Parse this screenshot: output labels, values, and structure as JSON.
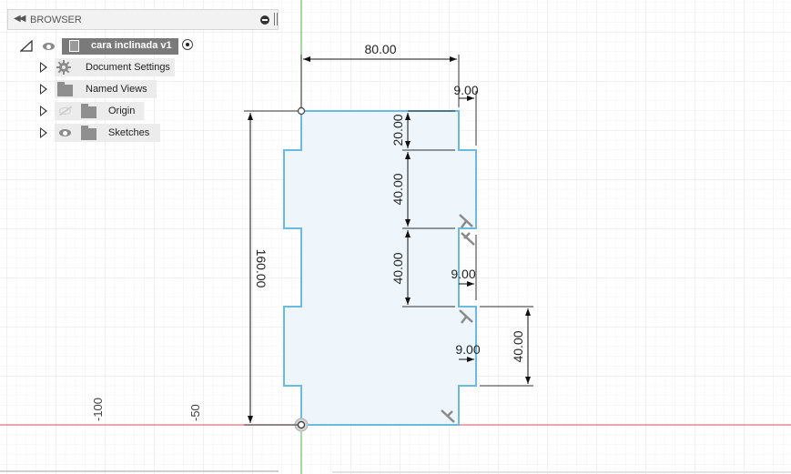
{
  "browser": {
    "title": "BROWSER",
    "component_name": "cara inclinada v1",
    "items": [
      {
        "label": "Document Settings",
        "icon": "gear-icon"
      },
      {
        "label": "Named Views",
        "icon": "folder-icon"
      },
      {
        "label": "Origin",
        "icon": "folder-icon",
        "visibility": "hidden"
      },
      {
        "label": "Sketches",
        "icon": "folder-icon",
        "visibility": "visible"
      }
    ]
  },
  "sketch": {
    "dimensions": {
      "width_top": "80.00",
      "height_total": "160.00",
      "tab_depth_top": "9.00",
      "tab_depth_mid": "9.00",
      "tab_depth_low": "9.00",
      "seg_top": "20.00",
      "seg_middle": "40.00",
      "seg_lower": "40.00",
      "seg_right": "40.00"
    },
    "axis_labels": {
      "neg100": "-100",
      "neg50": "-50"
    },
    "colors": {
      "profile_stroke": "#6bbbe0",
      "profile_fill": "#eef6fc",
      "x_axis": "#e0707a",
      "y_axis": "#6abf6a",
      "grid_major": "#e4e4e4",
      "grid_minor": "#f1f1f1"
    }
  }
}
